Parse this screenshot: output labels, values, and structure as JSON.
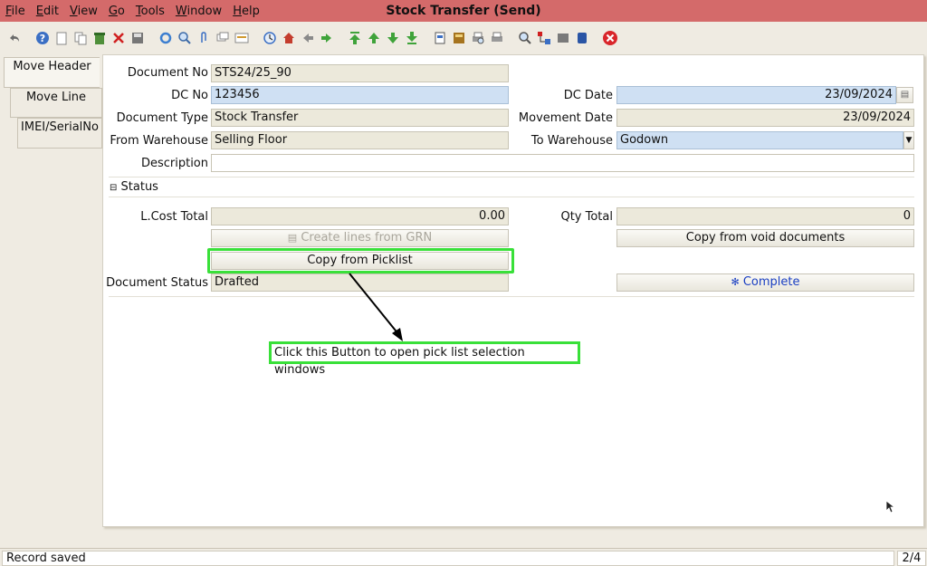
{
  "window": {
    "title": "Stock Transfer (Send)"
  },
  "menu": [
    "File",
    "Edit",
    "View",
    "Go",
    "Tools",
    "Window",
    "Help"
  ],
  "toolbar": {
    "icons": [
      "undo-icon",
      "help-icon",
      "new-icon",
      "copy-icon",
      "delete-icon",
      "save-icon",
      "refresh-icon",
      "find-icon",
      "attachment-icon",
      "chat-icon",
      "grid-toggle-icon",
      "history-icon",
      "home-icon",
      "back-icon",
      "forward-icon",
      "first-record-icon",
      "previous-record-icon",
      "next-record-icon",
      "last-record-icon",
      "report-icon",
      "archive-icon",
      "print-preview-icon",
      "print-icon",
      "zoom-across-icon",
      "active-workflows-icon",
      "requests-icon",
      "product-info-icon",
      "close-window-icon"
    ]
  },
  "tabs": [
    "Move Header",
    "Move Line",
    "IMEI/SerialNo"
  ],
  "form": {
    "document_no_label": "Document No",
    "document_no": "STS24/25_90",
    "dc_no_label": "DC No",
    "dc_no": "123456",
    "dc_date_label": "DC Date",
    "dc_date": "23/09/2024",
    "document_type_label": "Document Type",
    "document_type": "Stock Transfer",
    "movement_date_label": "Movement Date",
    "movement_date": "23/09/2024",
    "from_warehouse_label": "From Warehouse",
    "from_warehouse": "Selling Floor",
    "to_warehouse_label": "To Warehouse",
    "to_warehouse": "Godown",
    "description_label": "Description",
    "description": ""
  },
  "status_section": {
    "title": "Status",
    "lcost_total_label": "L.Cost Total",
    "lcost_total": "0.00",
    "qty_total_label": "Qty Total",
    "qty_total": "0",
    "create_lines_button": "Create lines from GRN",
    "copy_void_button": "Copy from void documents",
    "copy_picklist_button": "Copy from Picklist",
    "document_status_label": "Document Status",
    "document_status": "Drafted",
    "complete_button": "Complete"
  },
  "annotation": {
    "text": "Click this Button to open pick list selection windows"
  },
  "colors": {
    "title_bar": "#d46a6a",
    "highlight": "#39e039",
    "mandatory_field": "#cfe0f3"
  },
  "statusbar": {
    "message": "Record saved",
    "page": "2/4"
  }
}
